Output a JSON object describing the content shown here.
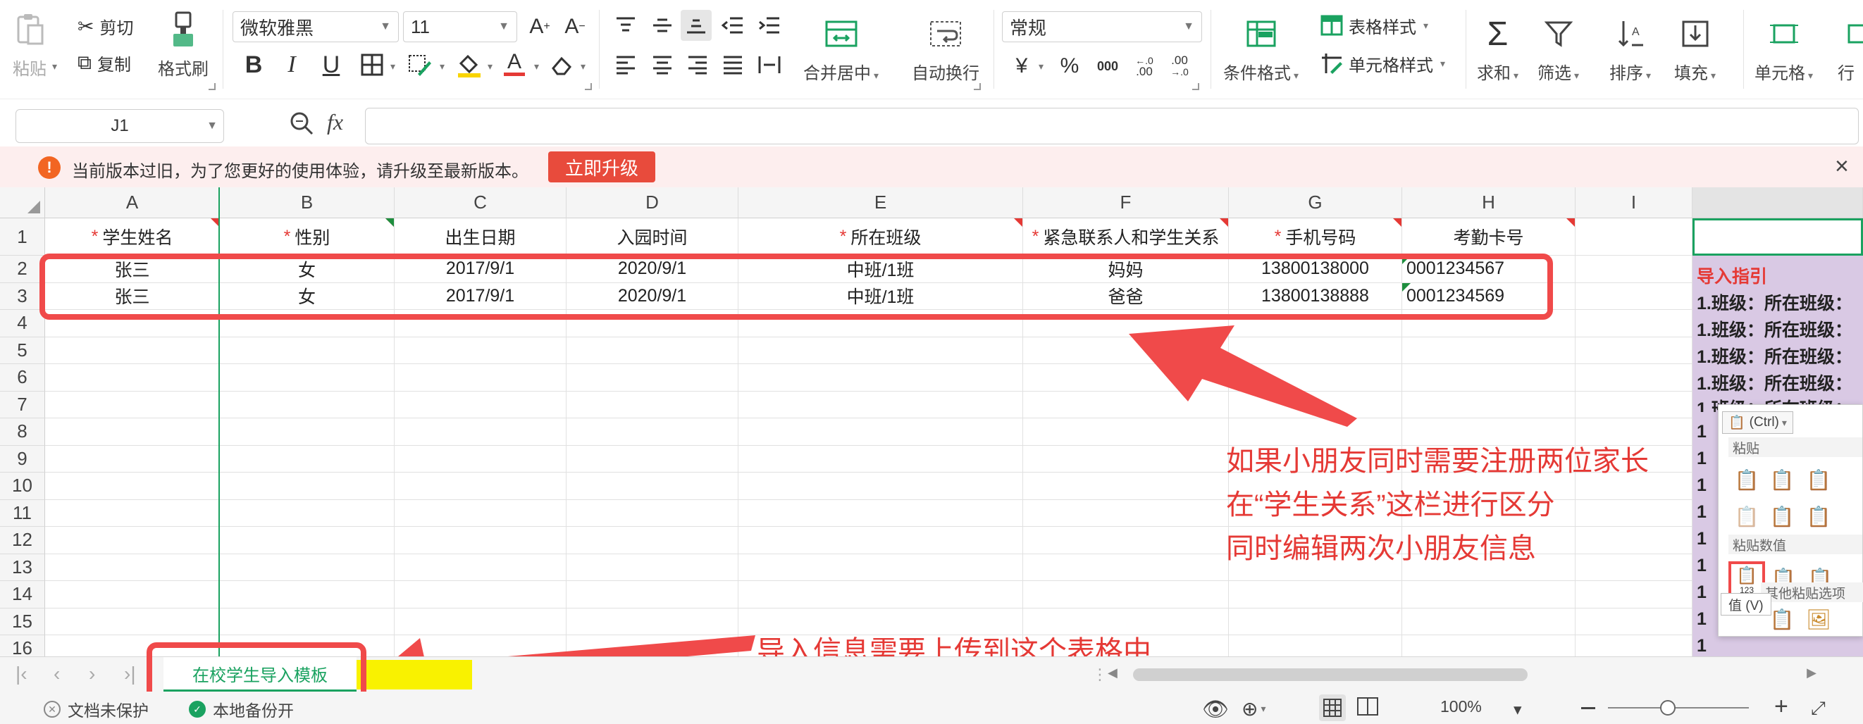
{
  "ribbon": {
    "paste": "粘贴",
    "cut": "剪切",
    "copy": "复制",
    "format_painter": "格式刷",
    "font_name": "微软雅黑",
    "font_size": "11",
    "increase_font": "A",
    "decrease_font": "A",
    "bold": "B",
    "italic": "I",
    "underline": "U",
    "font_color": "A",
    "merge_center": "合并居中",
    "wrap_text": "自动换行",
    "number_format": "常规",
    "currency": "¥",
    "percent": "%",
    "thousands": "000",
    "inc_decimal": ".00",
    "dec_decimal": ".00",
    "conditional_format": "条件格式",
    "table_style": "表格样式",
    "cell_style": "单元格样式",
    "sum": "求和",
    "filter": "筛选",
    "sort": "排序",
    "fill": "填充",
    "cell": "单元格",
    "row_col": "行"
  },
  "formula_bar": {
    "name_box": "J1",
    "fx": "fx",
    "formula": ""
  },
  "notice": {
    "message": "当前版本过旧，为了您更好的使用体验，请升级至最新版本。",
    "upgrade_button": "立即升级",
    "close": "×"
  },
  "grid": {
    "columns": [
      "A",
      "B",
      "C",
      "D",
      "E",
      "F",
      "G",
      "H",
      "I"
    ],
    "rows": [
      "1",
      "2",
      "3",
      "4",
      "5",
      "6",
      "7",
      "8",
      "9",
      "10",
      "11",
      "12",
      "13",
      "14",
      "15",
      "16"
    ],
    "header_cells": {
      "A": "学生姓名",
      "B": "性别",
      "C": "出生日期",
      "D": "入园时间",
      "E": "所在班级",
      "F": "紧急联系人和学生关系",
      "G": "手机号码",
      "H": "考勤卡号"
    },
    "required_mark": "*",
    "data_rows": [
      [
        "张三",
        "女",
        "2017/9/1",
        "2020/9/1",
        "中班/1班",
        "妈妈",
        "13800138000",
        "0001234567"
      ],
      [
        "张三",
        "女",
        "2017/9/1",
        "2020/9/1",
        "中班/1班",
        "爸爸",
        "13800138888",
        "0001234569"
      ]
    ]
  },
  "guide_panel": {
    "title": "导入指引",
    "lines": [
      "1.班级：所在班级：",
      "1.班级：所在班级：",
      "1.班级：所在班级：",
      "1.班级：所在班级：",
      "1.班级：所在班级："
    ],
    "bottom_rows": [
      "1",
      "1",
      "1",
      "1",
      "1",
      "1",
      "1",
      "1",
      "1"
    ]
  },
  "paste_popup": {
    "ctrl": "(Ctrl)",
    "section_paste": "粘贴",
    "section_values": "粘贴数值",
    "section_other": "其他粘贴选项",
    "tooltip": "值 (V)",
    "value_badge": "123"
  },
  "annotations": {
    "note_lines": [
      "如果小朋友同时需要注册两位家长",
      "在“学生关系”这栏进行区分",
      "同时编辑两次小朋友信息"
    ],
    "upload_note": "导入信息需要上传到这个表格中"
  },
  "tabs": {
    "sheet_name": "在校学生导入模板"
  },
  "status": {
    "doc_unprotected": "文档未保护",
    "local_backup": "本地备份开",
    "zoom": "100%"
  },
  "colors": {
    "accent_green": "#1aa260",
    "annotation_red": "#f04a4a",
    "upgrade_red": "#e84b3c",
    "panel_purple": "#d9c9e4"
  }
}
